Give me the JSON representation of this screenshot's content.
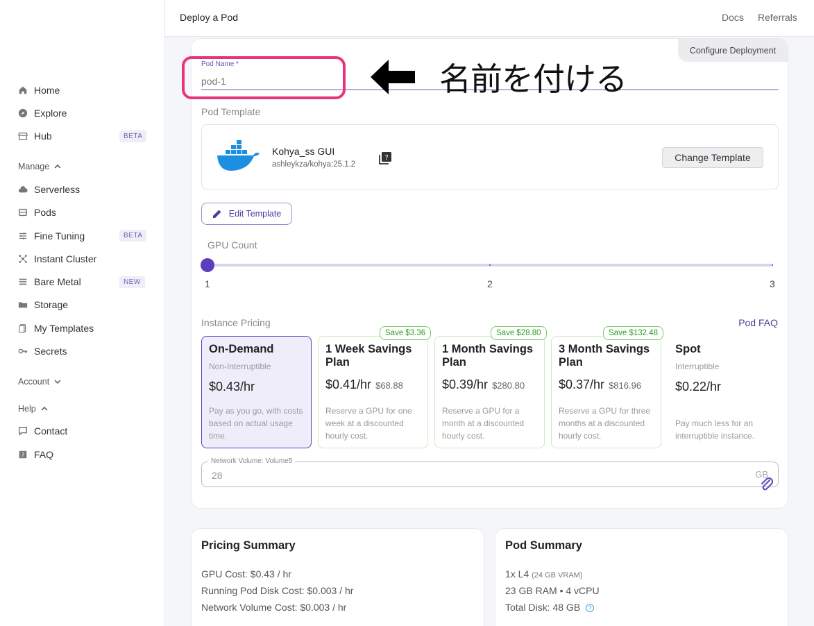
{
  "topbar": {
    "title": "Deploy a Pod",
    "links": [
      "Docs",
      "Referrals"
    ]
  },
  "sidebar": {
    "items": [
      {
        "label": "Home",
        "icon": "home-icon"
      },
      {
        "label": "Explore",
        "icon": "compass-icon"
      },
      {
        "label": "Hub",
        "icon": "store-icon",
        "badge": "BETA"
      }
    ],
    "manage_label": "Manage",
    "manage_items": [
      {
        "label": "Serverless",
        "icon": "cloud-icon"
      },
      {
        "label": "Pods",
        "icon": "server-icon"
      },
      {
        "label": "Fine Tuning",
        "icon": "sliders-icon",
        "badge": "BETA"
      },
      {
        "label": "Instant Cluster",
        "icon": "cluster-icon"
      },
      {
        "label": "Bare Metal",
        "icon": "list-icon",
        "badge": "NEW"
      },
      {
        "label": "Storage",
        "icon": "folder-icon"
      },
      {
        "label": "My Templates",
        "icon": "file-icon"
      },
      {
        "label": "Secrets",
        "icon": "key-icon"
      }
    ],
    "account_label": "Account",
    "help_label": "Help",
    "help_items": [
      {
        "label": "Contact",
        "icon": "chat-icon"
      },
      {
        "label": "FAQ",
        "icon": "question-icon"
      }
    ]
  },
  "deploy": {
    "config_tab": "Configure Deployment",
    "pod_name_label": "Pod Name *",
    "pod_name_placeholder": "pod-1",
    "annotation": "名前を付ける",
    "template_label": "Pod Template",
    "template": {
      "name": "Kohya_ss GUI",
      "image": "ashleykza/kohya:25.1.2",
      "change_button": "Change Template",
      "edit_button": "Edit Template"
    },
    "gpu_count_label": "GPU Count",
    "gpu_count_value": 1,
    "gpu_count_ticks": [
      "1",
      "2",
      "3"
    ],
    "pricing_label": "Instance Pricing",
    "pod_faq": "Pod FAQ",
    "plans": [
      {
        "title": "On-Demand",
        "sub": "Non-Interruptible",
        "price": "$0.43/hr",
        "total": "",
        "desc": "Pay as you go, with costs based on actual usage time.",
        "save": "",
        "selected": true
      },
      {
        "title": "1 Week Savings Plan",
        "sub": "",
        "price": "$0.41/hr",
        "total": "$68.88",
        "desc": "Reserve a GPU for one week at a discounted hourly cost.",
        "save": "Save $3.36",
        "selected": false
      },
      {
        "title": "1 Month Savings Plan",
        "sub": "",
        "price": "$0.39/hr",
        "total": "$280.80",
        "desc": "Reserve a GPU for a month at a discounted hourly cost.",
        "save": "Save $28.80",
        "selected": false
      },
      {
        "title": "3 Month Savings Plan",
        "sub": "",
        "price": "$0.37/hr",
        "total": "$816.96",
        "desc": "Reserve a GPU for three months at a discounted hourly cost.",
        "save": "Save $132.48",
        "selected": false
      },
      {
        "title": "Spot",
        "sub": "Interruptible",
        "price": "$0.22/hr",
        "total": "",
        "desc": "Pay much less for an interruptible instance.",
        "save": "",
        "selected": false
      }
    ],
    "volume_label": "Network Volume: Volume5",
    "volume_value": "28",
    "volume_unit": "GB"
  },
  "pricing_summary": {
    "title": "Pricing Summary",
    "lines": [
      "GPU Cost: $0.43 / hr",
      "Running Pod Disk Cost: $0.003 / hr",
      "Network Volume Cost: $0.003 / hr"
    ]
  },
  "pod_summary": {
    "title": "Pod Summary",
    "gpu": "1x L4",
    "vram": "(24 GB VRAM)",
    "specs": "23 GB RAM • 4 vCPU",
    "disk": "Total Disk: 48 GB"
  },
  "colors": {
    "accent": "#5b3fbf",
    "highlight": "#e8347a",
    "save_green": "#2d9a23"
  }
}
